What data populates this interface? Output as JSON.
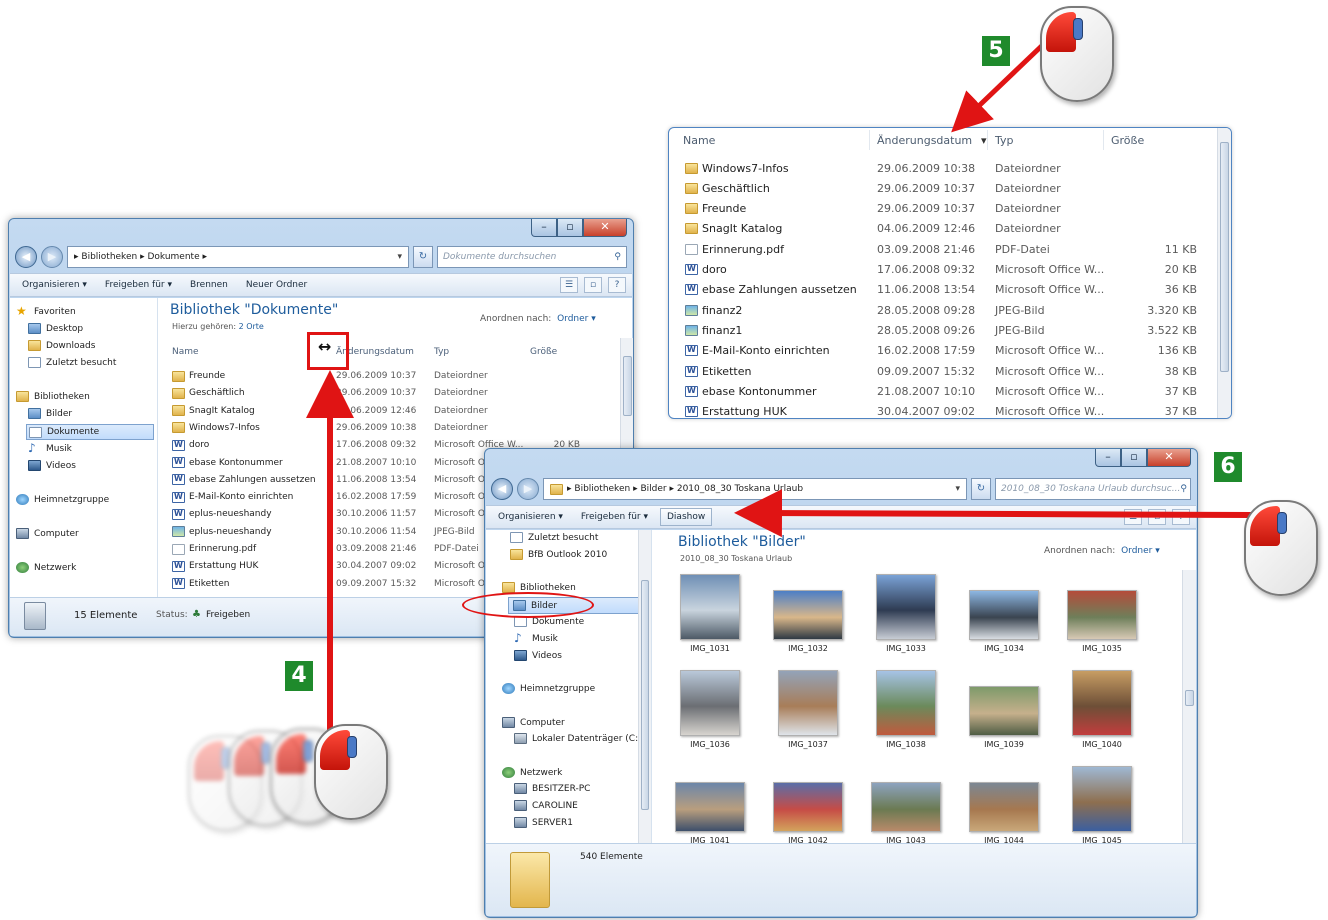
{
  "win1": {
    "breadcrumb": [
      "Bibliotheken",
      "Dokumente"
    ],
    "search_placeholder": "Dokumente durchsuchen",
    "toolbar": [
      "Organisieren ▾",
      "Freigeben für ▾",
      "Brennen",
      "Neuer Ordner"
    ],
    "nav": {
      "favoriten": "Favoriten",
      "desktop": "Desktop",
      "downloads": "Downloads",
      "zuletzt": "Zuletzt besucht",
      "bibliotheken": "Bibliotheken",
      "bilder": "Bilder",
      "dokumente": "Dokumente",
      "musik": "Musik",
      "videos": "Videos",
      "heimnetz": "Heimnetzgruppe",
      "computer": "Computer",
      "netzwerk": "Netzwerk"
    },
    "lib_title": "Bibliothek \"Dokumente\"",
    "lib_sub_prefix": "Hierzu gehören:",
    "lib_sub_link": "2 Orte",
    "arrange_label": "Anordnen nach:",
    "arrange_value": "Ordner ▾",
    "columns": {
      "name": "Name",
      "date": "Änderungsdatum",
      "type": "Typ",
      "size": "Größe"
    },
    "rows": [
      {
        "icon": "folder",
        "name": "Freunde",
        "date": "29.06.2009 10:37",
        "type": "Dateiordner",
        "size": ""
      },
      {
        "icon": "folder",
        "name": "Geschäftlich",
        "date": "29.06.2009 10:37",
        "type": "Dateiordner",
        "size": ""
      },
      {
        "icon": "folder",
        "name": "SnagIt Katalog",
        "date": "04.06.2009 12:46",
        "type": "Dateiordner",
        "size": ""
      },
      {
        "icon": "folder",
        "name": "Windows7-Infos",
        "date": "29.06.2009 10:38",
        "type": "Dateiordner",
        "size": ""
      },
      {
        "icon": "word",
        "name": "doro",
        "date": "17.06.2008 09:32",
        "type": "Microsoft Office W...",
        "size": "20 KB"
      },
      {
        "icon": "word",
        "name": "ebase Kontonummer",
        "date": "21.08.2007 10:10",
        "type": "Microsoft O",
        "size": ""
      },
      {
        "icon": "word",
        "name": "ebase Zahlungen aussetzen",
        "date": "11.06.2008 13:54",
        "type": "Microsoft O",
        "size": ""
      },
      {
        "icon": "word",
        "name": "E-Mail-Konto einrichten",
        "date": "16.02.2008 17:59",
        "type": "Microsoft O",
        "size": ""
      },
      {
        "icon": "word",
        "name": "eplus-neueshandy",
        "date": "30.10.2006 11:57",
        "type": "Microsoft O",
        "size": ""
      },
      {
        "icon": "img",
        "name": "eplus-neueshandy",
        "date": "30.10.2006 11:54",
        "type": "JPEG-Bild",
        "size": ""
      },
      {
        "icon": "pdf",
        "name": "Erinnerung.pdf",
        "date": "03.09.2008 21:46",
        "type": "PDF-Datei",
        "size": ""
      },
      {
        "icon": "word",
        "name": "Erstattung HUK",
        "date": "30.04.2007 09:02",
        "type": "Microsoft O",
        "size": ""
      },
      {
        "icon": "word",
        "name": "Etiketten",
        "date": "09.09.2007 15:32",
        "type": "Microsoft O",
        "size": ""
      }
    ],
    "status_count": "15 Elemente",
    "status_label": "Status:",
    "status_value": "Freigeben"
  },
  "panel": {
    "columns": {
      "name": "Name",
      "date": "Änderungsdatum",
      "type": "Typ",
      "size": "Größe"
    },
    "rows": [
      {
        "icon": "folder",
        "name": "Windows7-Infos",
        "date": "29.06.2009 10:38",
        "type": "Dateiordner",
        "size": ""
      },
      {
        "icon": "folder",
        "name": "Geschäftlich",
        "date": "29.06.2009 10:37",
        "type": "Dateiordner",
        "size": ""
      },
      {
        "icon": "folder",
        "name": "Freunde",
        "date": "29.06.2009 10:37",
        "type": "Dateiordner",
        "size": ""
      },
      {
        "icon": "folder",
        "name": "SnagIt Katalog",
        "date": "04.06.2009 12:46",
        "type": "Dateiordner",
        "size": ""
      },
      {
        "icon": "pdf",
        "name": "Erinnerung.pdf",
        "date": "03.09.2008 21:46",
        "type": "PDF-Datei",
        "size": "11 KB"
      },
      {
        "icon": "word",
        "name": "doro",
        "date": "17.06.2008 09:32",
        "type": "Microsoft Office W...",
        "size": "20 KB"
      },
      {
        "icon": "word",
        "name": "ebase Zahlungen aussetzen",
        "date": "11.06.2008 13:54",
        "type": "Microsoft Office W...",
        "size": "36 KB"
      },
      {
        "icon": "img",
        "name": "finanz2",
        "date": "28.05.2008 09:28",
        "type": "JPEG-Bild",
        "size": "3.320 KB"
      },
      {
        "icon": "img",
        "name": "finanz1",
        "date": "28.05.2008 09:26",
        "type": "JPEG-Bild",
        "size": "3.522 KB"
      },
      {
        "icon": "word",
        "name": "E-Mail-Konto einrichten",
        "date": "16.02.2008 17:59",
        "type": "Microsoft Office W...",
        "size": "136 KB"
      },
      {
        "icon": "word",
        "name": "Etiketten",
        "date": "09.09.2007 15:32",
        "type": "Microsoft Office W...",
        "size": "38 KB"
      },
      {
        "icon": "word",
        "name": "ebase Kontonummer",
        "date": "21.08.2007 10:10",
        "type": "Microsoft Office W...",
        "size": "37 KB"
      },
      {
        "icon": "word",
        "name": "Erstattung HUK",
        "date": "30.04.2007 09:02",
        "type": "Microsoft Office W...",
        "size": "37 KB"
      }
    ]
  },
  "win2": {
    "breadcrumb": [
      "Bibliotheken",
      "Bilder",
      "2010_08_30 Toskana Urlaub"
    ],
    "search_placeholder": "2010_08_30 Toskana Urlaub durchsuc...",
    "toolbar": [
      "Organisieren ▾",
      "Freigeben für ▾",
      "Diashow"
    ],
    "nav": {
      "zuletzt": "Zuletzt besucht",
      "outlook": "BfB Outlook 2010",
      "bibliotheken": "Bibliotheken",
      "bilder": "Bilder",
      "dokumente": "Dokumente",
      "musik": "Musik",
      "videos": "Videos",
      "heimnetz": "Heimnetzgruppe",
      "computer": "Computer",
      "lokal": "Lokaler Datenträger (C:)",
      "netzwerk": "Netzwerk",
      "besitzer": "BESITZER-PC",
      "caroline": "CAROLINE",
      "server": "SERVER1"
    },
    "lib_title": "Bibliothek \"Bilder\"",
    "lib_sub": "2010_08_30 Toskana Urlaub",
    "arrange_label": "Anordnen nach:",
    "arrange_value": "Ordner ▾",
    "thumbs": [
      "IMG_1031",
      "IMG_1032",
      "IMG_1033",
      "IMG_1034",
      "IMG_1035",
      "IMG_1036",
      "IMG_1037",
      "IMG_1038",
      "IMG_1039",
      "IMG_1040",
      "IMG_1041",
      "IMG_1042",
      "IMG_1043",
      "IMG_1044",
      "IMG_1045"
    ],
    "details_count": "540 Elemente"
  },
  "badges": {
    "b4": "4",
    "b5": "5",
    "b6": "6"
  },
  "colors": {
    "badge": "#1f8a2c",
    "arrow": "#e01414",
    "accent": "#1e5c9c"
  }
}
